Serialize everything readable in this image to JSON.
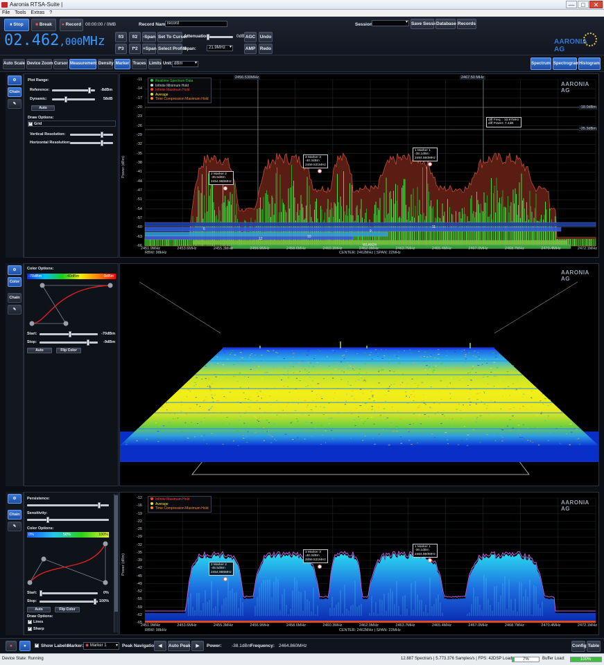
{
  "window": {
    "title": "Aaronia RTSA-Suite |",
    "controls": [
      "—",
      "□",
      "✕"
    ]
  },
  "menu": [
    "File",
    "Tools",
    "Extras",
    "?"
  ],
  "toolbar": {
    "stop_label": "Stop",
    "break_label": "Break",
    "record_label": "Record",
    "record_time": "00:00:00 / 0MB",
    "record_name_label": "Record Name:",
    "record_name_value": "record",
    "session_label": "Session:",
    "save_session_label": "Save Session",
    "database_label": "Database",
    "records_label": "Records",
    "f3_label": "f/3",
    "f2_label": "f/2",
    "fx3_label": "f*3",
    "fx2_label": "f*2",
    "minus_span_label": "-Span",
    "plus_span_label": "+Span",
    "set_to_cursor_label": "Set To Cursor",
    "select_profile_label": "Select Profile",
    "attenuation_label": "Attenuation:",
    "attenuation_value": "0dB",
    "span_label": "Span:",
    "span_value": "21.9MHz",
    "agc_label": "AGC",
    "amp_label": "AMP",
    "undo_label": "Undo",
    "redo_label": "Redo",
    "center_freq_main": "02.462",
    "center_freq_small": ",000",
    "center_freq_unit": "MHz",
    "logo_text": "AARONIA AG"
  },
  "toolbar2": {
    "items": [
      "Auto Scale",
      "Device Zoom",
      "Cursor",
      "Measurement",
      "Density",
      "Marker",
      "Traces",
      "Limits"
    ],
    "active": [
      "Measurement",
      "Marker"
    ],
    "unit_label": "Unit:",
    "unit_value": "dBm",
    "views": [
      "Spectrum",
      "Spectrogram",
      "Histogram"
    ]
  },
  "side": {
    "gear_label": "⚙",
    "chain_label": "Chain",
    "color_label": "Color",
    "tool_label": "✎"
  },
  "panel1": {
    "plot_range_label": "Plot Range:",
    "reference_label": "Reference:",
    "reference_value": "-8dBm",
    "dynamic_label": "Dynamic:",
    "dynamic_value": "58dB",
    "auto_label": "Auto",
    "draw_options_label": "Draw Options:",
    "grid_label": "Grid",
    "vres_label": "Vertical Resolution:",
    "hres_label": "Horizontal Resolution:"
  },
  "panel2": {
    "color_options_label": "Color Options:",
    "grad_left": "-70dBm",
    "grad_mid": "-40dBm",
    "grad_right": "-9dBm",
    "start_label": "Start:",
    "start_value": "-70dBm",
    "stop_label": "Stop:",
    "stop_value": "-9dBm",
    "auto_label": "Auto",
    "flip_label": "Flip Color"
  },
  "panel3": {
    "persistence_label": "Persistence:",
    "sensitivity_label": "Sensitivity:",
    "color_options_label": "Color Options:",
    "grad_left": "0%",
    "grad_mid": "50%",
    "grad_right": "100%",
    "start_label": "Start:",
    "start_value": "0%",
    "stop_label": "Stop:",
    "stop_value": "100%",
    "auto_label": "Auto",
    "flip_label": "Flip Color",
    "draw_options_label": "Draw Options:",
    "lines_label": "Lines",
    "sharp_label": "Sharp"
  },
  "spectrum": {
    "ylabel": "Power (dBm)",
    "yticks": [
      "-11",
      "-14",
      "-17",
      "-20",
      "-23",
      "-26",
      "-29",
      "-32",
      "-35",
      "-38",
      "-41",
      "-44",
      "-47",
      "-51",
      "-54",
      "-57",
      "-60",
      "-63",
      "-66"
    ],
    "xticks": [
      "2451.9MHz",
      "2453.6MHz",
      "2455.3MHz",
      "2456.9MHz",
      "2458.6MHz",
      "2460.3MHz",
      "2462.0MHz",
      "2463.7MHz",
      "2465.4MHz",
      "2467.0MHz",
      "2468.7MHz",
      "2470.4MHz",
      "2472.1MHz"
    ],
    "rbw": "RBW: 98kHz",
    "center_span": "CENTER: 2462MHz | SPAN: 22MHz",
    "top_label_left": "2456.530MHz",
    "top_label_right": "2467.50 MHz",
    "ref_line_1": "-18.0dBm",
    "ref_line_2": "-25.3dBm",
    "diff_label": "diff Freq. : 10.97MHz\ndiff Power: 7.4dB",
    "legend": [
      "Realtime Spectrum Data",
      "Infinite Minimum Hold",
      "Infinite Maximum Hold",
      "Average",
      "Time Compression Maximum Hold"
    ],
    "legend_colors": [
      "#36d13a",
      "#d8d8d8",
      "#ff4040",
      "#f2e33a",
      "#ff8a2a"
    ],
    "channels": [
      "6",
      "9",
      "11",
      "10",
      "12",
      "WLAN24"
    ],
    "markers": [
      {
        "text": "2 Marker 2\n-45.5dBm\n2454.986MHz"
      },
      {
        "text": "3 Marker 3\n-40.3dBm\n2459.531MHz"
      },
      {
        "text": "1 Marker 1\n-38.1dBm\n2464.860MHz"
      }
    ]
  },
  "histogram": {
    "ylabel": "Power (dBm)",
    "yticks": [
      "-12",
      "-16",
      "-19",
      "-22",
      "-25",
      "-29",
      "-32",
      "-35",
      "-39",
      "-42",
      "-45",
      "-49",
      "-52",
      "-55",
      "-59",
      "-62",
      "-65"
    ],
    "xticks": [
      "2451.9MHz",
      "2453.6MHz",
      "2455.3MHz",
      "2456.9MHz",
      "2458.6MHz",
      "2460.3MHz",
      "2462.0MHz",
      "2463.7MHz",
      "2465.4MHz",
      "2467.0MHz",
      "2468.7MHz",
      "2470.4MHz",
      "2472.1MHz"
    ],
    "rbw": "RBW: 98kHz",
    "center_span": "CENTER: 2462MHz | SPAN: 22MHz",
    "legend": [
      "Infinite Maximum Hold",
      "Average",
      "Time Compression Maximum Hold"
    ],
    "legend_colors": [
      "#ff4040",
      "#f2e33a",
      "#ff8a2a"
    ],
    "markers": [
      {
        "text": "2 Marker 2\n-45.5dBm\n2454.986MHz"
      },
      {
        "text": "3 Marker 3\n-40.3dBm\n2459.531MHz"
      },
      {
        "text": "1 Marker 1\n-38.1dBm\n2464.860MHz"
      }
    ]
  },
  "bottombar": {
    "show_labels": "Show Labels",
    "marker_label": "Marker:",
    "marker_value": "Marker 1",
    "peak_nav_label": "Peak Navigation:",
    "auto_peak_label": "Auto Peak",
    "power_label": "Power:",
    "power_value": "-38.1dBm",
    "frequency_label": "Frequency:",
    "frequency_value": "2464.860MHz",
    "config_label": "Config",
    "table_label": "Table"
  },
  "statusbar": {
    "device_state": "Device State: Running",
    "spectra": "12.887 Spectra/s | 5.773.376 Samples/s | FPS: 42",
    "dsp_label": "DSP Load:",
    "dsp_value": "7%",
    "buffer_label": "Buffer Load:",
    "buffer_value": "100%"
  },
  "colors": {
    "accent": "#2e6fd6",
    "trace_green": "#36d13a",
    "max_hold": "#ff4040",
    "background": "#000000"
  }
}
